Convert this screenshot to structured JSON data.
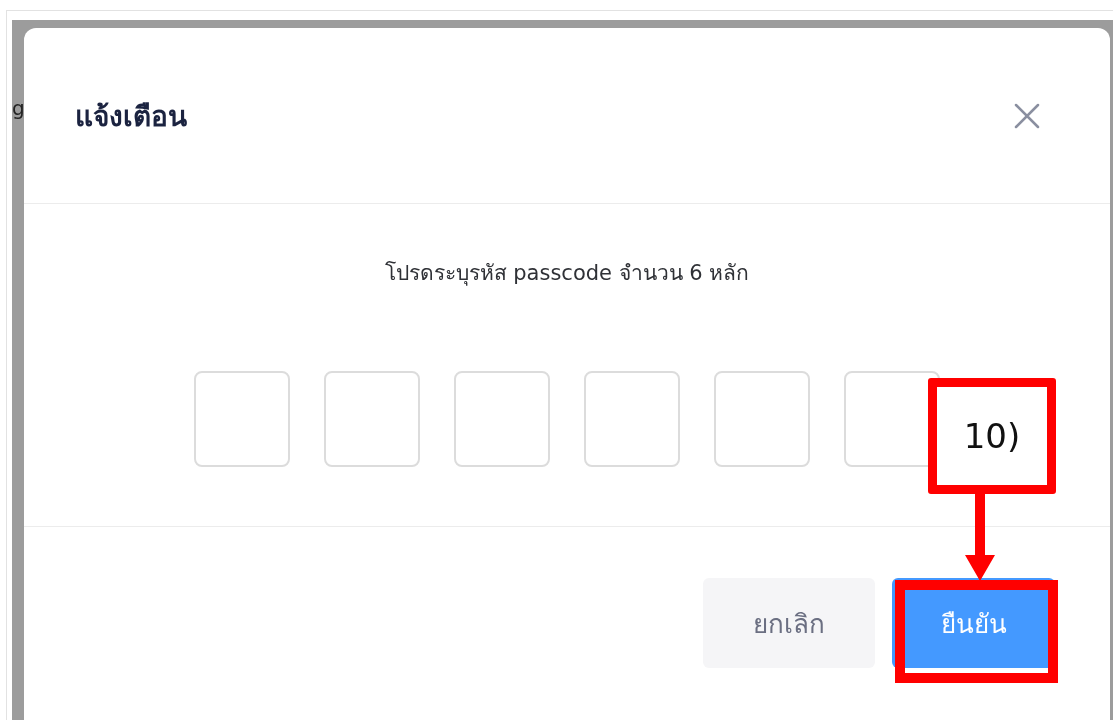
{
  "background": {
    "text_fragment": "g"
  },
  "dialog": {
    "title": "แจ้งเตือน",
    "message": "โปรดระบุรหัส passcode จำนวน 6 หลัก",
    "passcode_boxes": [
      {
        "filled": false
      },
      {
        "filled": false
      },
      {
        "filled": false
      },
      {
        "filled": false
      },
      {
        "filled": false
      },
      {
        "filled": false
      }
    ],
    "buttons": [
      {
        "label": "ยกเลิก",
        "kind": "secondary"
      },
      {
        "label": "ยืนยัน",
        "kind": "primary"
      }
    ]
  },
  "annotation": {
    "label": "10)"
  }
}
